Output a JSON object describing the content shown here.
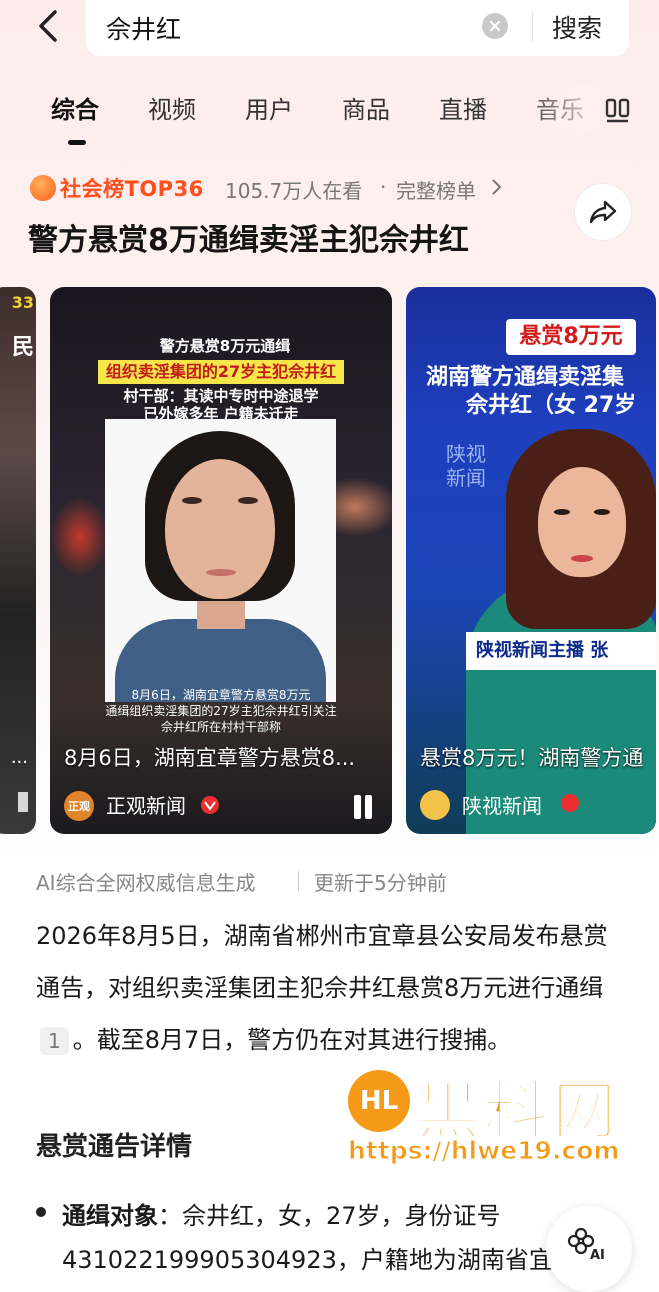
{
  "search": {
    "query": "佘井红",
    "button_label": "搜索"
  },
  "tabs": [
    {
      "label": "综合",
      "active": true
    },
    {
      "label": "视频"
    },
    {
      "label": "用户"
    },
    {
      "label": "商品"
    },
    {
      "label": "直播"
    },
    {
      "label": "音乐"
    }
  ],
  "hot": {
    "rank_label": "社会榜TOP36",
    "watching": "105.7万人在看",
    "sep": "·",
    "link": "完整榜单",
    "headline": "警方悬赏8万通缉卖淫主犯佘井红"
  },
  "videos": [
    {
      "overlay_line1": "警方悬赏8万元通缉",
      "overlay_highlight": "组织卖淫集团的27岁主犯佘井红",
      "overlay_line3": "村干部：其读中专时中途退学",
      "overlay_line4": "已外嫁多年 户籍未迁走",
      "caption_line1": "8月6日，湖南宜章警方悬赏8万元",
      "caption_line2": "通缉组织卖淫集团的27岁主犯佘井红引关注",
      "caption_line3": "佘井红所在村村干部称",
      "title": "8月6日，湖南宜章警方悬赏8...",
      "logo_text": "正观",
      "author": "正观新闻"
    },
    {
      "banner": "悬赏8万元",
      "line2": "湖南警方通缉卖淫集",
      "line3": "佘井红（女 27岁",
      "brand": "陕视新闻",
      "lower_third": "陕视新闻主播 张",
      "title": "悬赏8万元！湖南警方通",
      "author": "陕视新闻"
    }
  ],
  "left_card": {
    "label1": "33",
    "label2": "民",
    "dots": "..."
  },
  "ai": {
    "source": "AI综合全网权威信息生成",
    "updated": "更新于5分钟前",
    "summary_part1": "2026年8月5日，湖南省郴州市宜章县公安局发布悬赏通告，对组织卖淫集团主犯佘井红悬赏8万元进行通缉",
    "cite": "1",
    "summary_part2": "。截至8月7日，警方仍在对其进行搜捕。",
    "section_title": "悬赏通告详情",
    "bullet_label": "通缉对象",
    "bullet_text": "：佘井红，女，27岁，身份证号431022199905304923，户籍地为湖南省宜"
  },
  "watermark": {
    "logo": "HL",
    "text": "黑料网",
    "url": "https://hlwe19.com"
  },
  "fab": {
    "label": "AI"
  }
}
